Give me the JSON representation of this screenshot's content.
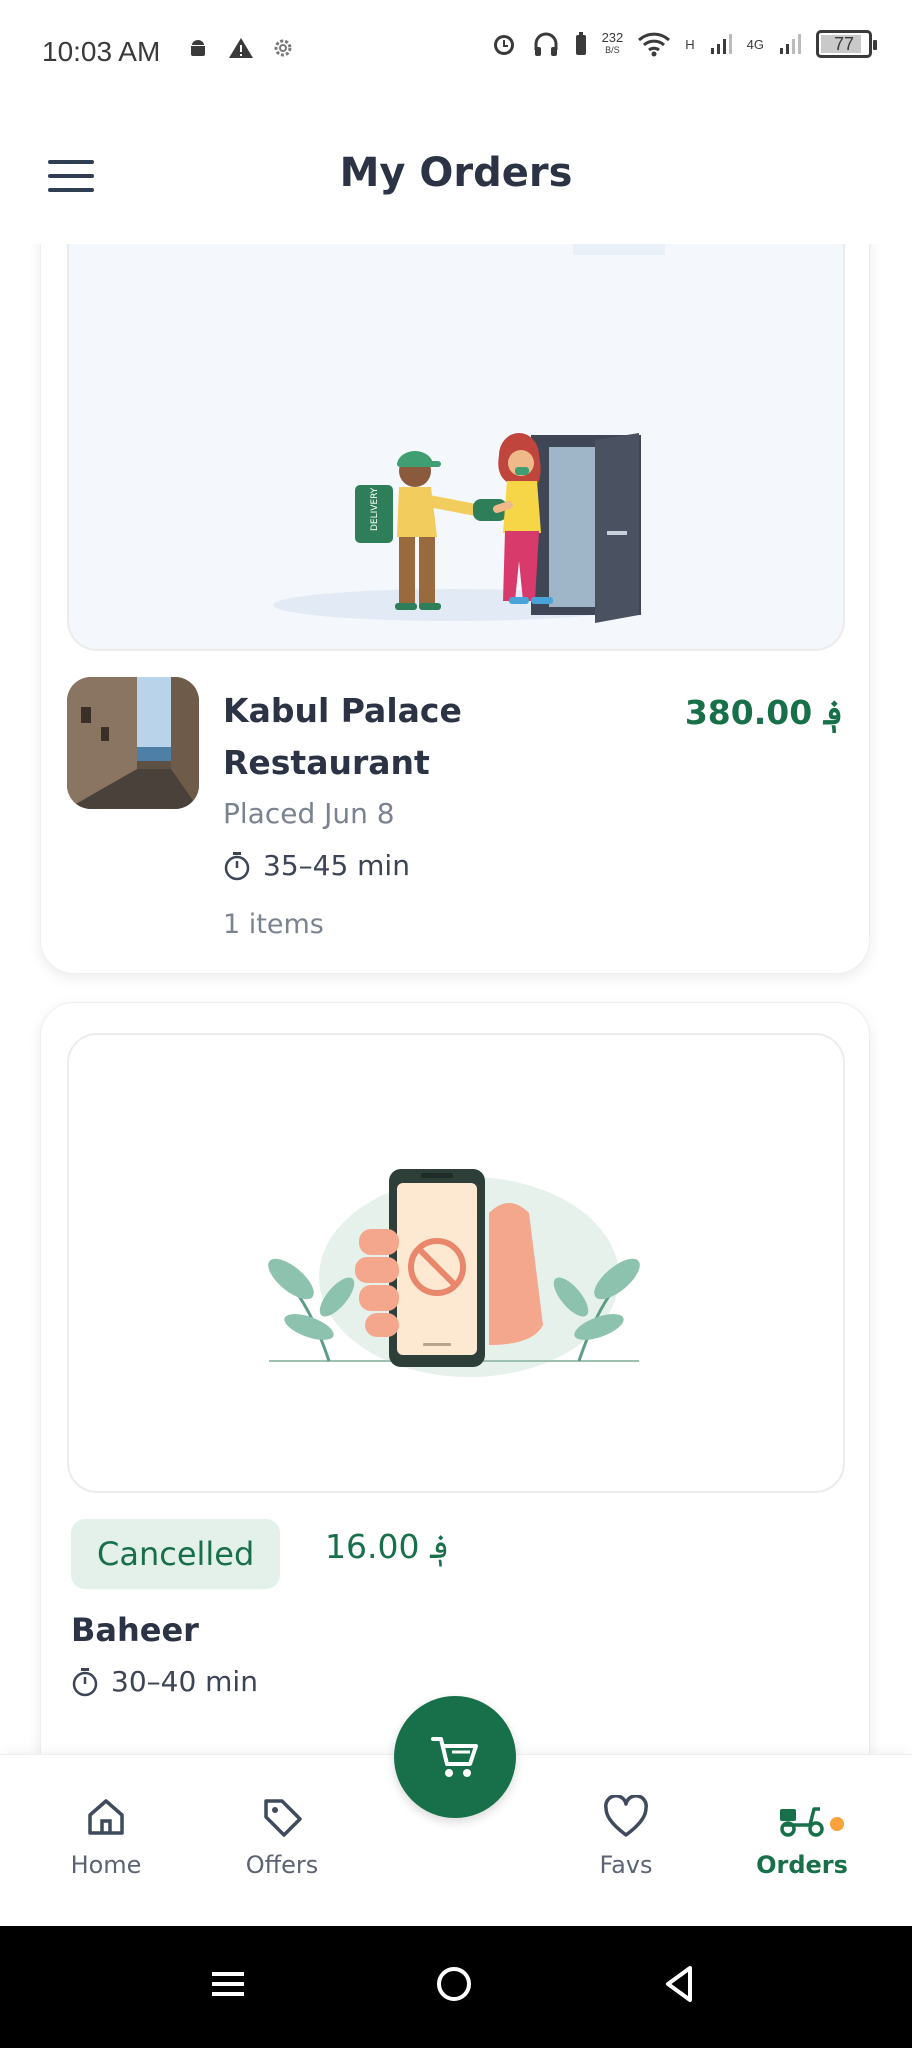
{
  "status_bar": {
    "time": "10:03 AM",
    "net_speed": "232",
    "net_unit": "B/S",
    "h_label": "H",
    "g_label": "4G",
    "battery": "77"
  },
  "header": {
    "title": "My Orders"
  },
  "orders": [
    {
      "restaurant": "Kabul Palace Restaurant",
      "price": "380.00 ؋",
      "placed": "Placed Jun 8",
      "delivery_time": "35–45 min",
      "items": "1 items"
    },
    {
      "status": "Cancelled",
      "price": "16.00 ؋",
      "restaurant": "Baheer",
      "delivery_time": "30–40 min"
    }
  ],
  "illustration_text": {
    "bag_label": "DELIVERY"
  },
  "bottom_nav": {
    "items": [
      {
        "label": "Home",
        "icon": "home-icon"
      },
      {
        "label": "Offers",
        "icon": "tag-icon"
      },
      {
        "label": "Favs",
        "icon": "heart-icon"
      },
      {
        "label": "Orders",
        "icon": "scooter-icon",
        "active": true
      }
    ],
    "fab_icon": "cart-icon"
  },
  "colors": {
    "brand": "#18704a",
    "badge_bg": "#e4f1ea",
    "notification_dot": "#f7a23b"
  }
}
